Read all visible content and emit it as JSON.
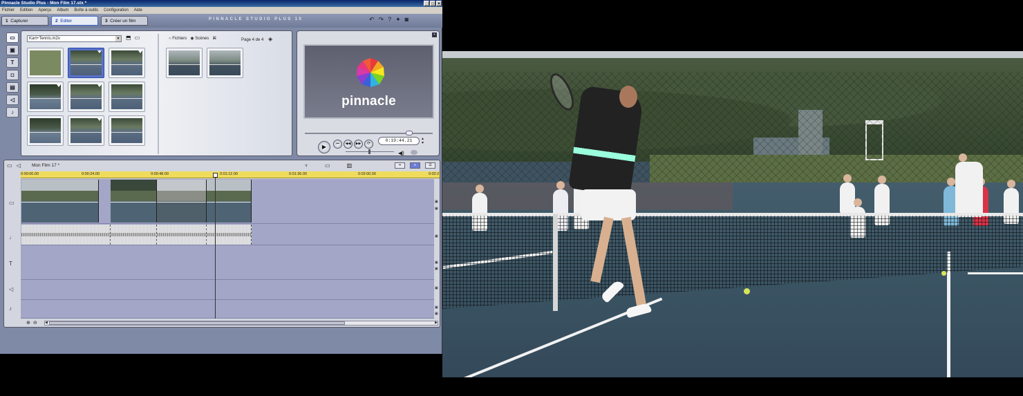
{
  "window": {
    "title": "Pinnacle Studio Plus - Mon Film 17.stx *",
    "buttons": [
      "_",
      "□",
      "×"
    ]
  },
  "menu": [
    "Fichier",
    "Edition",
    "Aperçu",
    "Album",
    "Boîte à outils",
    "Configuration",
    "Aide"
  ],
  "tabs": [
    {
      "num": "1",
      "label": "Capturer"
    },
    {
      "num": "2",
      "label": "Editer"
    },
    {
      "num": "3",
      "label": "Créer un film"
    }
  ],
  "brand": "PINNACLE STUDIO PLUS 10",
  "album": {
    "file": "Kart+Tennis.m2v",
    "radio_files": "Fichiers",
    "radio_scenes": "Scènes",
    "page": "Page 4 de 4"
  },
  "player": {
    "logo_text": "pinnacle",
    "timecode": "0:19:44.21"
  },
  "timeline": {
    "title": "Mon Film 17 *",
    "ruler": [
      "0:00:00.00",
      "0:00:24.00",
      "0:00:48.00",
      "0:01:12.00",
      "0:01:36.00",
      "0:02:00.00",
      "0:02:2"
    ]
  },
  "colors": {
    "accent": "#4468c8",
    "ruler": "#f0dc5c",
    "track_bg": "#a3a6c6"
  }
}
